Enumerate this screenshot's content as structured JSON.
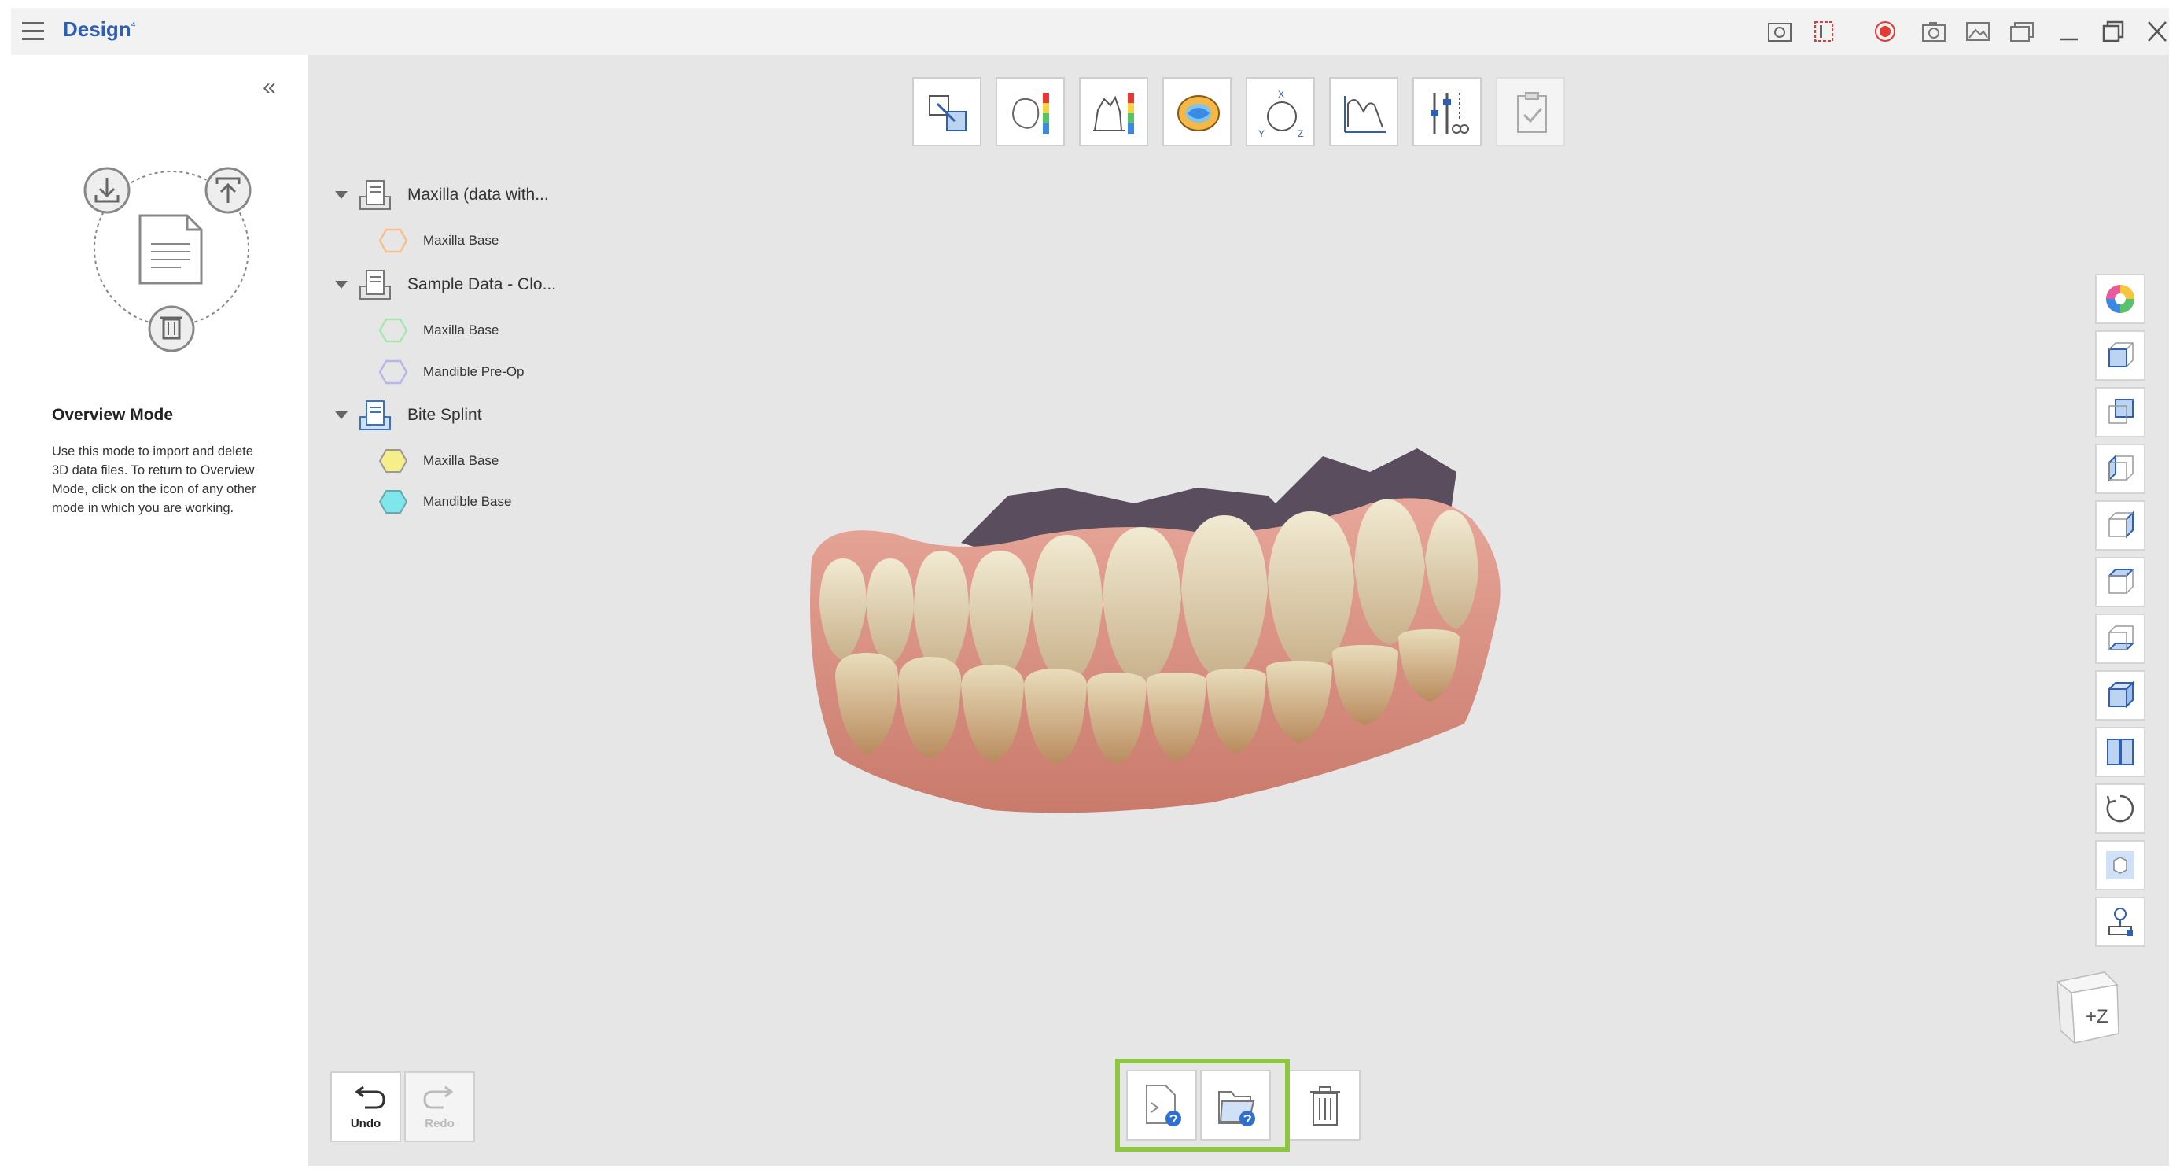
{
  "app": {
    "title": "Design",
    "title_suffix": "⁲⁴"
  },
  "titlebar_icons": [
    "screenshot-camera-icon",
    "record-area-icon",
    "record-icon",
    "camera-icon",
    "image-icon",
    "gallery-icon",
    "minimize-icon",
    "restore-icon",
    "close-icon"
  ],
  "left_panel": {
    "mode_title": "Overview Mode",
    "mode_description": "Use this mode to import and delete 3D data files. To return to Overview Mode, click on the icon of any other mode in which you are working."
  },
  "toolbar": {
    "tools": [
      "align-tool-icon",
      "deviation-map-icon",
      "cross-section-icon",
      "occlusion-icon",
      "axis-setup-icon",
      "measure-tool-icon",
      "adjust-tool-icon",
      "complete-icon"
    ]
  },
  "tree": {
    "groups": [
      {
        "label": "Maxilla (data with...",
        "items": [
          {
            "label": "Maxilla Base",
            "color": "#f5c08a"
          }
        ]
      },
      {
        "label": "Sample Data - Clo...",
        "items": [
          {
            "label": "Maxilla Base",
            "color": "#a8e6b0"
          },
          {
            "label": "Mandible Pre-Op",
            "color": "#b6b6ea"
          }
        ]
      },
      {
        "label": "Bite Splint",
        "items": [
          {
            "label": "Maxilla Base",
            "color": "#f6ee8a"
          },
          {
            "label": "Mandible Base",
            "color": "#7fe6ec"
          }
        ]
      }
    ]
  },
  "bottom": {
    "undo_label": "Undo",
    "redo_label": "Redo"
  },
  "orientation_cube": {
    "label": "+Z"
  },
  "colors": {
    "accent": "#2f5fb3",
    "highlight_frame": "#8dc63f",
    "record_red": "#e53935"
  }
}
